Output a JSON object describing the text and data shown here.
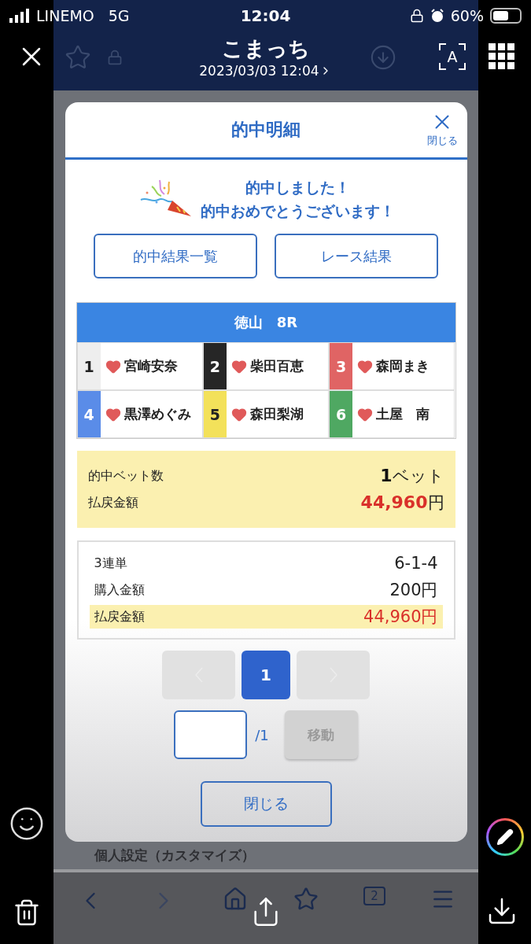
{
  "status_bar": {
    "carrier": "LINEMO",
    "network": "5G",
    "time": "12:04",
    "battery": "60%"
  },
  "viewer": {
    "title": "こまっち",
    "subtitle": "2023/03/03 12:04",
    "live_text_label": "A"
  },
  "browser": {
    "behind_text": "個人設定（カスタマイズ）",
    "tab_count": "2"
  },
  "modal": {
    "title": "的中明細",
    "close_label": "閉じる",
    "message": [
      "的中しました！",
      "的中おめでとうございます！"
    ],
    "links": [
      "的中結果一覧",
      "レース結果"
    ],
    "race": {
      "title": "徳山　8R",
      "racers": [
        {
          "number": "1",
          "name": "宮崎安奈",
          "color": "#eeeeee"
        },
        {
          "number": "2",
          "name": "柴田百恵",
          "color": "#262626"
        },
        {
          "number": "3",
          "name": "森岡まき",
          "color": "#e06464"
        },
        {
          "number": "4",
          "name": "黒澤めぐみ",
          "color": "#5a8ce8"
        },
        {
          "number": "5",
          "name": "森田梨湖",
          "color": "#f3e15a"
        },
        {
          "number": "6",
          "name": "土屋　南",
          "color": "#4fa862"
        }
      ]
    },
    "summary": [
      {
        "kind": "count",
        "label": "的中ベット数",
        "value": "1",
        "unit": "ベット"
      },
      {
        "kind": "money",
        "label": "払戻金額",
        "value": "44,960",
        "unit": "円"
      }
    ],
    "bet_rows": [
      {
        "label": "3連単",
        "value": "6-1-4",
        "highlight": false
      },
      {
        "label": "購入金額",
        "value": "200円",
        "highlight": false
      },
      {
        "label": "払戻金額",
        "value": "44,960円",
        "highlight": true
      }
    ],
    "pagination": {
      "prev_disabled": true,
      "next_disabled": true,
      "pages": [
        {
          "label": "1",
          "selected": true
        }
      ]
    },
    "jump": {
      "total": "/1",
      "button": "移動",
      "disabled": true
    },
    "close_button": "閉じる"
  }
}
